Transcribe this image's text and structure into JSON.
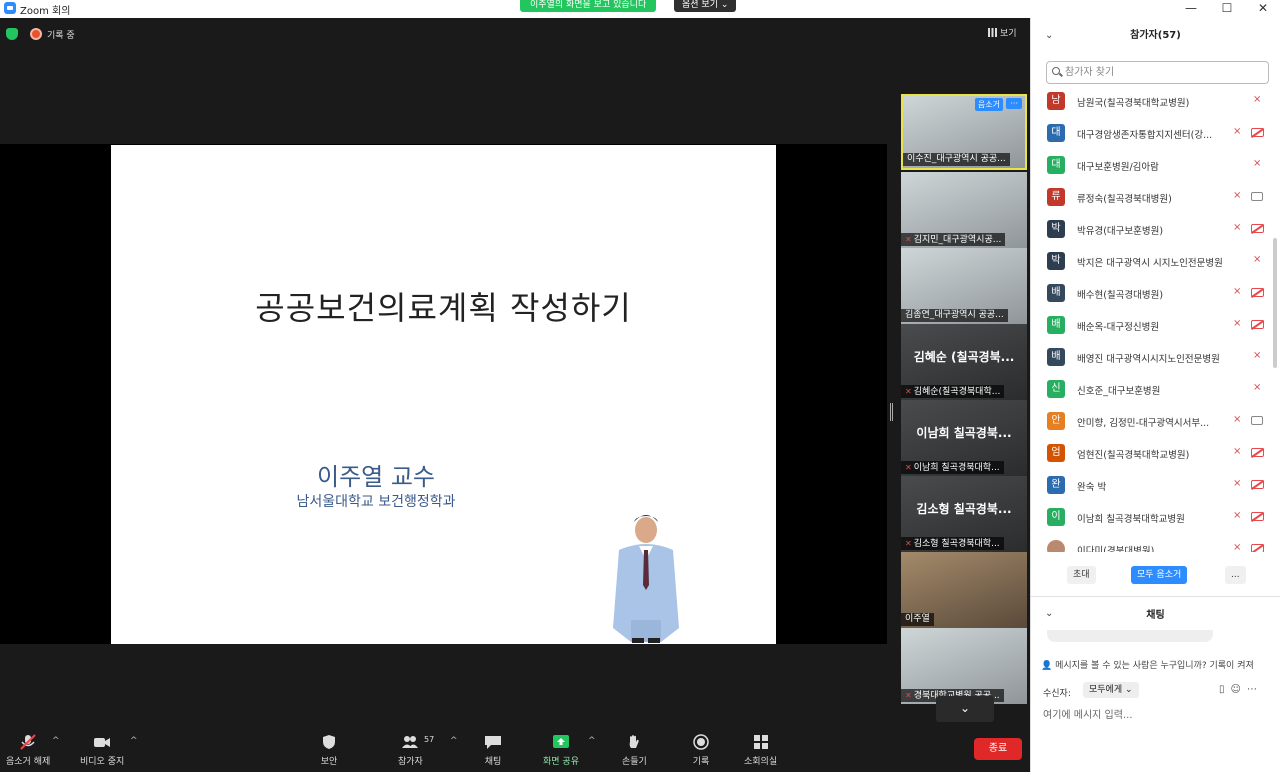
{
  "window": {
    "title": "Zoom 회의",
    "minimize": "—",
    "maximize": "☐",
    "close": "✕"
  },
  "banner": {
    "sharing_text": "이주열의 화면을 보고 있습니다",
    "view_options": "옵션 보기 ⌄"
  },
  "meeting": {
    "recording_label": "기록 중",
    "view_label": "보기"
  },
  "slide": {
    "title": "공공보건의료계획   작성하기",
    "speaker": "이주열 교수",
    "affiliation": "남서울대학교 보건행정학과"
  },
  "gallery": {
    "tiles": [
      {
        "label": "이수진_대구광역시 공공...",
        "unmute": "음소거",
        "more": "···"
      },
      {
        "label": "김지민_대구광역시공..."
      },
      {
        "label": "김종연_대구광역시 공공..."
      },
      {
        "big_name": "김혜순 (칠곡경북...",
        "label": "김혜순(칠곡경북대학..."
      },
      {
        "big_name": "이남희 칠곡경북...",
        "label": "이남희 칠곡경북대학..."
      },
      {
        "big_name": "김소형 칠곡경북...",
        "label": "김소형 칠곡경북대학..."
      },
      {
        "label": "이주열"
      },
      {
        "label": "경북대학교병원 공공..."
      }
    ],
    "scroll_down": "⌄"
  },
  "toolbar": {
    "unmute": "음소거 해제",
    "stop_video": "비디오 중지",
    "security": "보안",
    "participants": "참가자",
    "participant_count": "57",
    "chat": "채팅",
    "share_screen": "화면 공유",
    "raise_hand": "손들기",
    "record": "기록",
    "breakout": "소회의실",
    "end": "종료"
  },
  "participants_panel": {
    "title": "참가자(57)",
    "search_placeholder": "참가자 찾기",
    "participants": [
      {
        "initial": "남",
        "name": "남원국(칠곡경북대학교병원)",
        "color": "#c0392b",
        "cam": "none"
      },
      {
        "initial": "대",
        "name": "대구경암생존자통합지지센터(강...",
        "color": "#2b6cb0",
        "cam": "off"
      },
      {
        "initial": "대",
        "name": "대구보훈병원/김아람",
        "color": "#27ae60",
        "cam": "none"
      },
      {
        "initial": "류",
        "name": "류정숙(칠곡경북대병원)",
        "color": "#c0392b",
        "cam": "on"
      },
      {
        "initial": "박",
        "name": "박유경(대구보훈병원)",
        "color": "#2c3e50",
        "cam": "off"
      },
      {
        "initial": "박",
        "name": "박지은 대구광역시 시지노인전문병원",
        "color": "#2c3e50",
        "cam": "none"
      },
      {
        "initial": "배",
        "name": "배수현(칠곡경대병원)",
        "color": "#34495e",
        "cam": "off"
      },
      {
        "initial": "배",
        "name": "배순옥-대구정신병원",
        "color": "#27ae60",
        "cam": "off"
      },
      {
        "initial": "배",
        "name": "배영진 대구광역시시지노인전문병원",
        "color": "#34495e",
        "cam": "none"
      },
      {
        "initial": "신",
        "name": "신호준_대구보훈병원",
        "color": "#27ae60",
        "cam": "none"
      },
      {
        "initial": "안",
        "name": "안미향, 김정민-대구광역시서부...",
        "color": "#e67e22",
        "cam": "on"
      },
      {
        "initial": "엄",
        "name": "엄현진(칠곡경북대학교병원)",
        "color": "#d35400",
        "cam": "off"
      },
      {
        "initial": "완",
        "name": "완숙 박",
        "color": "#2b6cb0",
        "cam": "off"
      },
      {
        "initial": "이",
        "name": "이남희 칠곡경북대학교병원",
        "color": "#27ae60",
        "cam": "off"
      },
      {
        "initial": "",
        "name": "이다미(경북대병원)",
        "color": "#b98a6e",
        "cam": "off"
      }
    ],
    "invite": "초대",
    "mute_all": "모두 음소거",
    "more": "..."
  },
  "chat_panel": {
    "title": "채팅",
    "notice": "메시지를 볼 수 있는 사람은 누구입니까? 기록이 켜져",
    "to_label": "수신자:",
    "to_value": "모두에게 ⌄",
    "input_placeholder": "여기에 메시지 입력..."
  },
  "colors": {
    "accent": "#2d8cff",
    "end": "#e02828",
    "share_green": "#22c55e",
    "active_speaker": "#e8e34a"
  }
}
